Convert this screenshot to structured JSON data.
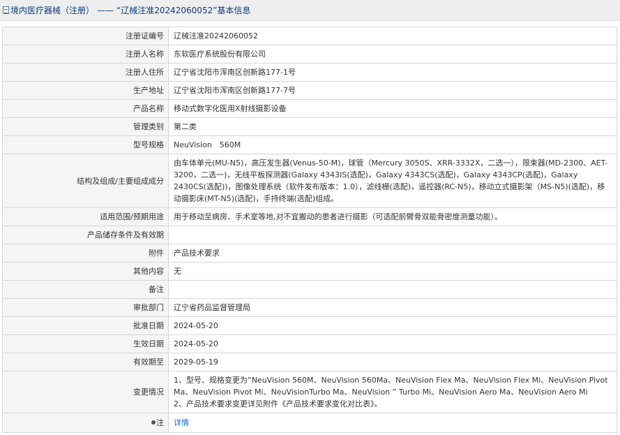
{
  "header": {
    "title_prefix": "境内医疗器械（注册）",
    "title_separator": "——",
    "title_main": "“辽械注准20242060052”基本信息",
    "icon": "document-icon"
  },
  "colors": {
    "title_text": "#0a3d7a",
    "label_bg": "#f5f5f5",
    "border": "#d6d6d6",
    "link": "#1a66cc"
  },
  "rows": [
    {
      "label": "注册证编号",
      "value": "辽械注准20242060052"
    },
    {
      "label": "注册人名称",
      "value": "东软医疗系统股份有限公司"
    },
    {
      "label": "注册人住所",
      "value": "辽宁省沈阳市浑南区创新路177-1号"
    },
    {
      "label": "生产地址",
      "value": "辽宁省沈阳市浑南区创新路177-7号"
    },
    {
      "label": "产品名称",
      "value": "移动式数字化医用X射线摄影设备"
    },
    {
      "label": "管理类别",
      "value": "第二类"
    },
    {
      "label": "型号规格",
      "value": "NeuVision　560M"
    },
    {
      "label": "结构及组成/主要组成成分",
      "value": "由车体单元(MU-N5)，高压发生器(Venus-50-M)，球管（Mercury 3050S、XRR-3332X，二选一），限束器(MD-2300、AET-3200，二选一)，无线平板探测器(Galaxy 4343IS(选配)，Galaxy 4343CS(选配)，Galaxy 4343CP(选配)，Galaxy 2430CS(选配))，图像处理系统（软件发布版本：1.0），滤线栅(选配)，遥控器(RC-N5)，移动立式摄影架（MS-N5)(选配)，移动摄影床(MT-N5)(选配)，手持终端(选配)组成。"
    },
    {
      "label": "适用范围/预期用途",
      "value": "用于移动至病房、手术室等地,对不宜搬动的患者进行摄影（可选配前臂骨双能骨密度测量功能）。"
    },
    {
      "label": "产品储存条件及有效期",
      "value": ""
    },
    {
      "label": "附件",
      "value": "产品技术要求"
    },
    {
      "label": "其他内容",
      "value": "无"
    },
    {
      "label": "备注",
      "value": ""
    },
    {
      "label": "审批部门",
      "value": "辽宁省药品监督管理局"
    },
    {
      "label": "批准日期",
      "value": "2024-05-20"
    },
    {
      "label": "生效日期",
      "value": "2024-05-20"
    },
    {
      "label": "有效期至",
      "value": "2029-05-19"
    }
  ],
  "change": {
    "label": "变更情况",
    "line1": "1、型号、规格变更为“NeuVision 560M、NeuVision 560Ma、NeuVision Flex Ma、NeuVision Flex Mi、NeuVision Pivot Ma、NeuVision Pivot Mi、NeuVisionTurbo Ma、NeuVision ” Turbo Mi、NeuVision Aero Ma、NeuVision Aero Mi",
    "line2": "2、产品技术要求变更详见附件《产品技术要求变化对比表》。"
  },
  "note": {
    "label": "注",
    "icon": "pin-icon",
    "link_text": "详情"
  }
}
